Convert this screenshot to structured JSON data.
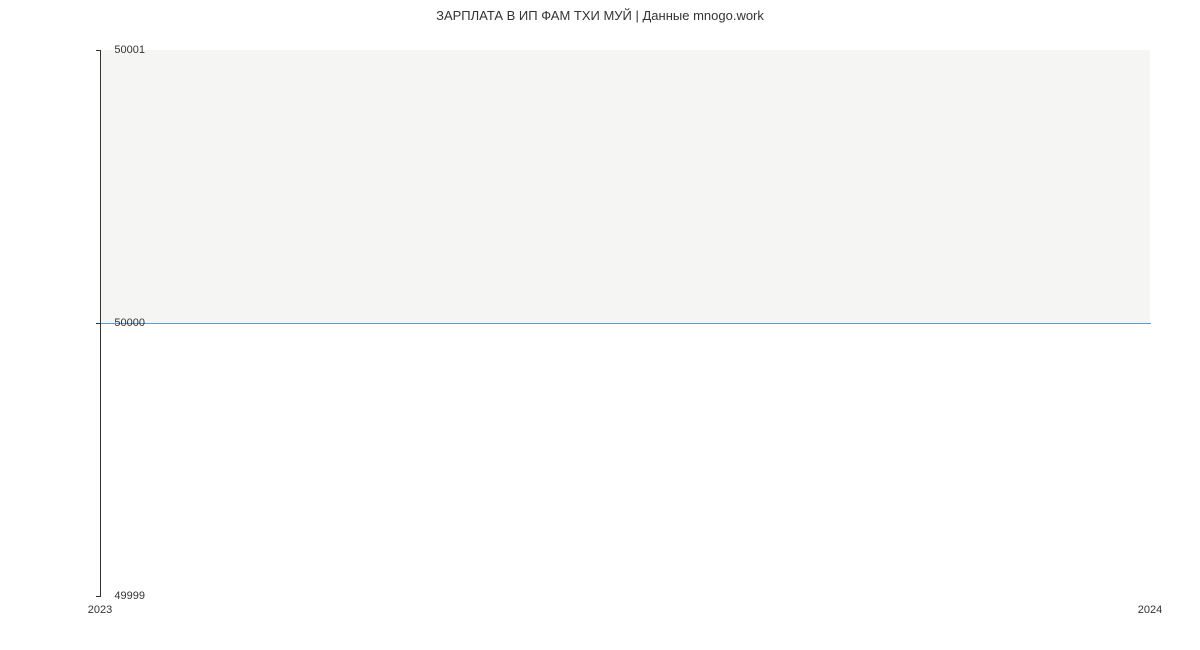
{
  "chart_data": {
    "type": "line",
    "title": "ЗАРПЛАТА В ИП ФАМ ТХИ МУЙ | Данные mnogo.work",
    "xlabel": "",
    "ylabel": "",
    "x": [
      2023,
      2024
    ],
    "values": [
      50000,
      50000
    ],
    "x_ticks": [
      "2023",
      "2024"
    ],
    "y_ticks": [
      "49999",
      "50000",
      "50001"
    ],
    "ylim": [
      49999,
      50001
    ],
    "xlim": [
      2023,
      2024
    ],
    "line_color": "#5b9bd5"
  }
}
